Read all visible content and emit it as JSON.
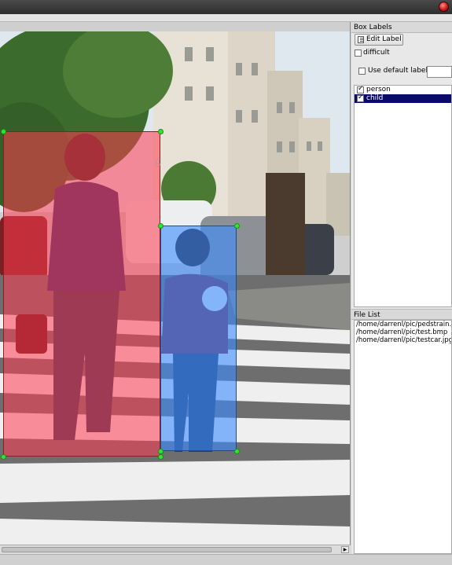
{
  "window": {
    "close_icon": "close-icon"
  },
  "canvas": {
    "boxes": [
      {
        "label": "person",
        "color": "#ff3b50"
      },
      {
        "label": "child",
        "color": "#3b8cff"
      }
    ]
  },
  "box_labels_panel": {
    "title": "Box Labels",
    "edit_label_button": "Edit Label",
    "difficult_label": "difficult",
    "difficult_checked": false,
    "use_default_label": "Use default label",
    "use_default_checked": false,
    "default_label_value": "",
    "labels": [
      {
        "text": "person",
        "checked": true,
        "selected": false
      },
      {
        "text": "child",
        "checked": true,
        "selected": true
      }
    ]
  },
  "file_list_panel": {
    "title": "File List",
    "files": [
      "/home/darrenl/pic/pedstrain.jpg",
      "/home/darrenl/pic/test.bmp",
      "/home/darrenl/pic/testcar.jpg"
    ]
  },
  "colors": {
    "selection": "#0a0a6a",
    "handle": "#2ee62e"
  }
}
